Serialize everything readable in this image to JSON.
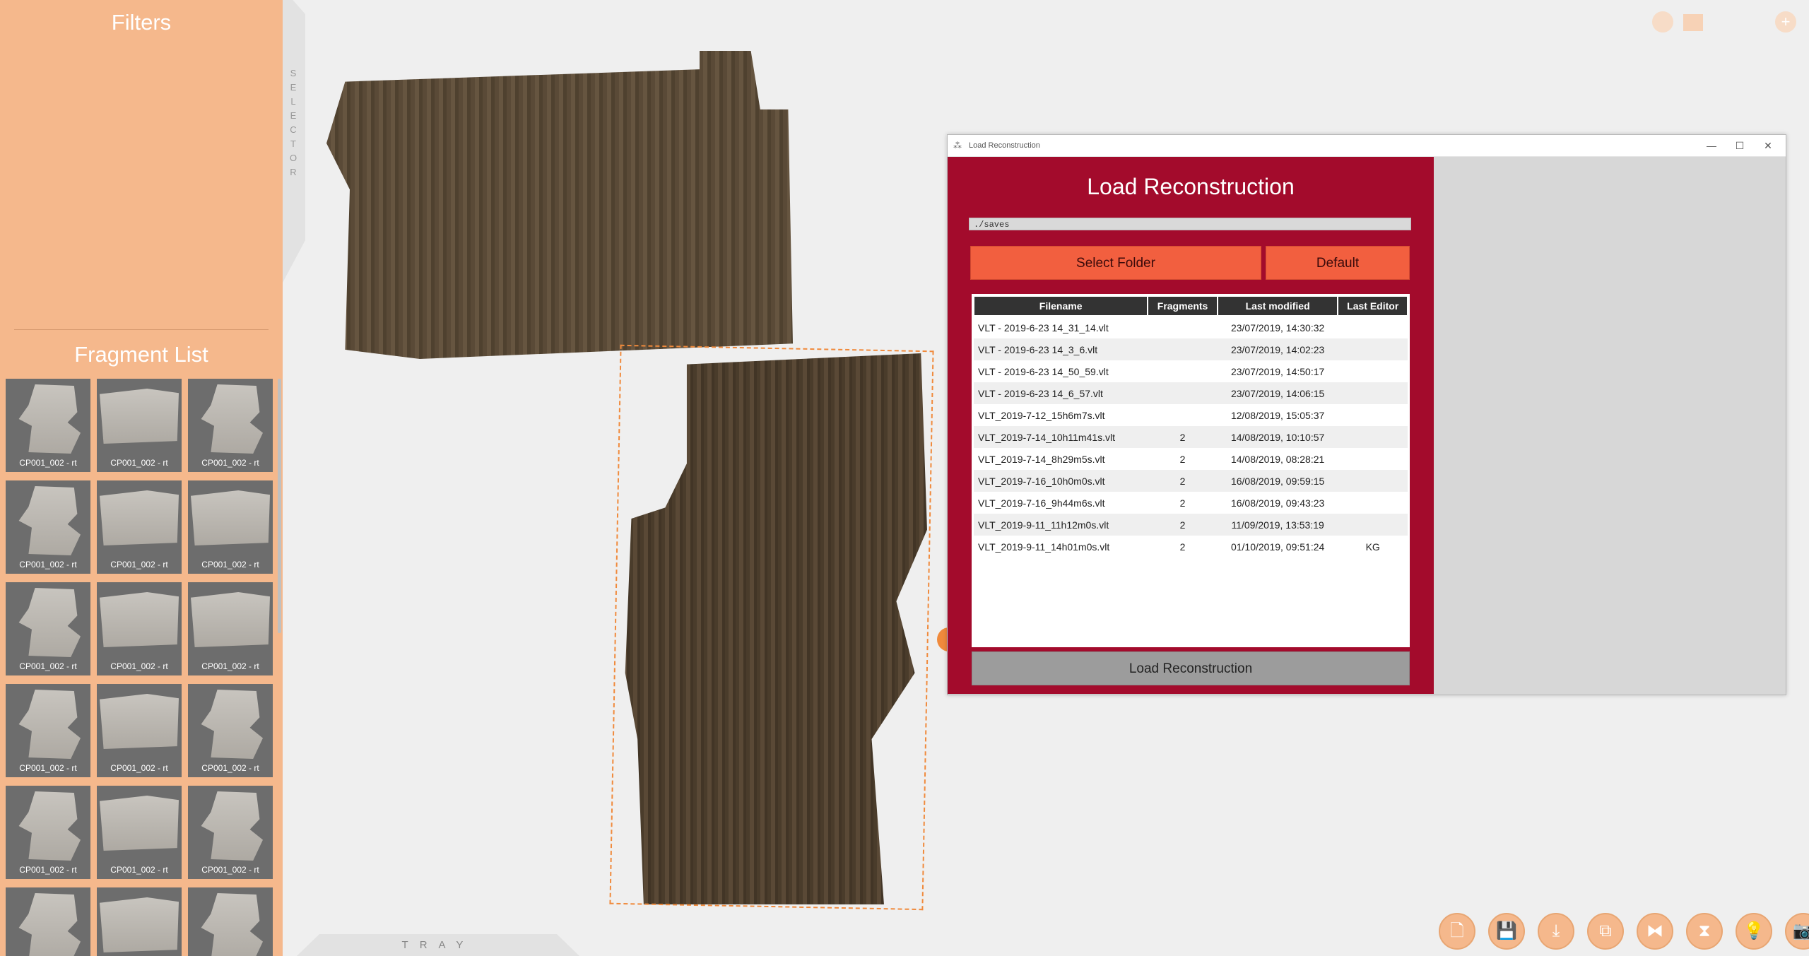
{
  "sidebar": {
    "filters_title": "Filters",
    "fragment_list_title": "Fragment List",
    "fragments": [
      {
        "label": "CP001_002 - rt"
      },
      {
        "label": "CP001_002 - rt"
      },
      {
        "label": "CP001_002 - rt"
      },
      {
        "label": "CP001_002 - rt"
      },
      {
        "label": "CP001_002 - rt"
      },
      {
        "label": "CP001_002 - rt"
      },
      {
        "label": "CP001_002 - rt"
      },
      {
        "label": "CP001_002 - rt"
      },
      {
        "label": "CP001_002 - rt"
      },
      {
        "label": "CP001_002 - rt"
      },
      {
        "label": "CP001_002 - rt"
      },
      {
        "label": "CP001_002 - rt"
      },
      {
        "label": "CP001_002 - rt"
      },
      {
        "label": "CP001_002 - rt"
      },
      {
        "label": "CP001_002 - rt"
      },
      {
        "label": ""
      },
      {
        "label": ""
      },
      {
        "label": ""
      }
    ]
  },
  "selector_label": "SELECTOR",
  "tray_label": "TRAY",
  "dialog": {
    "window_title": "Load Reconstruction",
    "title": "Load Reconstruction",
    "path": "./saves",
    "select_folder_label": "Select Folder",
    "default_label": "Default",
    "columns": [
      "Filename",
      "Fragments",
      "Last modified",
      "Last Editor"
    ],
    "rows": [
      {
        "filename": "VLT - 2019-6-23 14_31_14.vlt",
        "fragments": "",
        "modified": "23/07/2019, 14:30:32",
        "editor": ""
      },
      {
        "filename": "VLT - 2019-6-23 14_3_6.vlt",
        "fragments": "",
        "modified": "23/07/2019, 14:02:23",
        "editor": ""
      },
      {
        "filename": "VLT - 2019-6-23 14_50_59.vlt",
        "fragments": "",
        "modified": "23/07/2019, 14:50:17",
        "editor": ""
      },
      {
        "filename": "VLT - 2019-6-23 14_6_57.vlt",
        "fragments": "",
        "modified": "23/07/2019, 14:06:15",
        "editor": ""
      },
      {
        "filename": "VLT_2019-7-12_15h6m7s.vlt",
        "fragments": "",
        "modified": "12/08/2019, 15:05:37",
        "editor": ""
      },
      {
        "filename": "VLT_2019-7-14_10h11m41s.vlt",
        "fragments": "2",
        "modified": "14/08/2019, 10:10:57",
        "editor": ""
      },
      {
        "filename": "VLT_2019-7-14_8h29m5s.vlt",
        "fragments": "2",
        "modified": "14/08/2019, 08:28:21",
        "editor": ""
      },
      {
        "filename": "VLT_2019-7-16_10h0m0s.vlt",
        "fragments": "2",
        "modified": "16/08/2019, 09:59:15",
        "editor": ""
      },
      {
        "filename": "VLT_2019-7-16_9h44m6s.vlt",
        "fragments": "2",
        "modified": "16/08/2019, 09:43:23",
        "editor": ""
      },
      {
        "filename": "VLT_2019-9-11_11h12m0s.vlt",
        "fragments": "2",
        "modified": "11/09/2019, 13:53:19",
        "editor": ""
      },
      {
        "filename": "VLT_2019-9-11_14h01m0s.vlt",
        "fragments": "2",
        "modified": "01/10/2019, 09:51:24",
        "editor": "KG"
      }
    ],
    "load_button_label": "Load Reconstruction"
  },
  "toolbar": {
    "icons": [
      "new-file-icon",
      "save-icon",
      "save-as-icon",
      "copy-icon",
      "flip-horizontal-icon",
      "flip-vertical-icon",
      "lightbulb-icon",
      "screenshot-icon"
    ],
    "glyphs": [
      "🗋",
      "💾",
      "⤓",
      "⧉",
      "⧓",
      "⧗",
      "💡",
      "📷"
    ]
  },
  "colors": {
    "sidebar": "#f5b88c",
    "dialog_panel": "#a30b2c",
    "button_orange": "#f25f3f"
  }
}
